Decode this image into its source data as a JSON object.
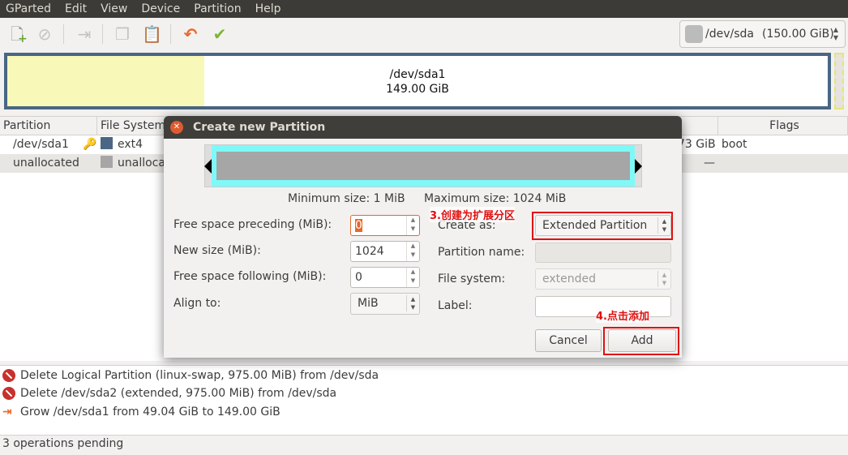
{
  "menu": [
    "GParted",
    "Edit",
    "View",
    "Device",
    "Partition",
    "Help"
  ],
  "toolbar": {
    "icons": [
      "new-icon",
      "delete-icon",
      "resize-move-icon",
      "copy-icon",
      "paste-icon",
      "undo-icon",
      "apply-icon"
    ]
  },
  "device": {
    "name": "/dev/sda",
    "size": "(150.00 GiB)"
  },
  "diskmap": {
    "name": "/dev/sda1",
    "size": "149.00 GiB",
    "used_fraction": 0.24
  },
  "table": {
    "headers": {
      "partition": "Partition",
      "filesystem": "File System",
      "flags": "Flags"
    },
    "rows": [
      {
        "partition": "/dev/sda1",
        "filesystem": "ext4",
        "fs_color": "#4a6684",
        "size_tail": "73 GiB",
        "flags": "boot"
      },
      {
        "partition": "unallocated",
        "filesystem": "unalloca",
        "fs_color": "#a6a6a6",
        "size_tail": "—",
        "flags": ""
      }
    ]
  },
  "log": [
    {
      "icon": "delete-icon",
      "text": "Delete Logical Partition (linux-swap, 975.00 MiB) from /dev/sda"
    },
    {
      "icon": "delete-icon",
      "text": "Delete /dev/sda2 (extended, 975.00 MiB) from /dev/sda"
    },
    {
      "icon": "grow-icon",
      "text": "Grow /dev/sda1 from 49.04 GiB to 149.00 GiB"
    }
  ],
  "status": "3 operations pending",
  "dialog": {
    "title": "Create new Partition",
    "min_size": "Minimum size: 1 MiB",
    "max_size": "Maximum size: 1024 MiB",
    "free_preceding_label": "Free space preceding (MiB):",
    "free_preceding": "0",
    "new_size_label": "New size (MiB):",
    "new_size": "1024",
    "free_following_label": "Free space following (MiB):",
    "free_following": "0",
    "align_label": "Align to:",
    "align": "MiB",
    "create_as_label": "Create as:",
    "create_as": "Extended Partition",
    "partition_name_label": "Partition name:",
    "partition_name": "",
    "filesystem_label": "File system:",
    "filesystem": "extended",
    "label_label": "Label:",
    "label": "",
    "cancel": "Cancel",
    "add": "Add"
  },
  "annotations": {
    "step3": "3.创建为扩展分区",
    "step4": "4.点击添加",
    "color": "#e01010"
  }
}
